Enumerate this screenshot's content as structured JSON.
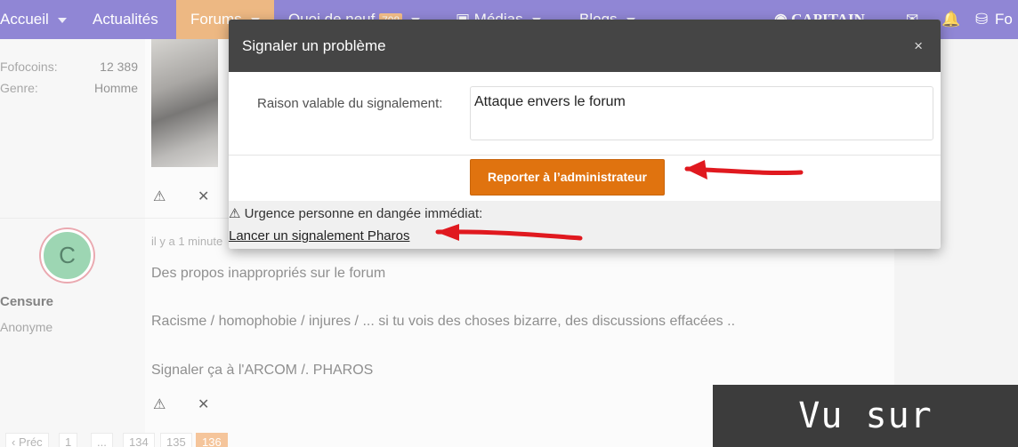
{
  "nav": {
    "items": [
      {
        "label": "Accueil"
      },
      {
        "label": "Actualités"
      },
      {
        "label": "Forums"
      },
      {
        "label": "Quoi de neuf",
        "badge": "708"
      },
      {
        "label": "Médias"
      },
      {
        "label": "Blogs"
      }
    ],
    "user": "CAPITAIN",
    "right_label": "Fo"
  },
  "sidebar": {
    "stats": [
      {
        "label": "Fofocoins:",
        "value": "12 389"
      },
      {
        "label": "Genre:",
        "value": "Homme"
      }
    ]
  },
  "post": {
    "avatar_letter": "C",
    "username": "Censure",
    "role": "Anonyme",
    "time": "il y a 1 minute",
    "lines": [
      "Des propos inappropriés sur le forum",
      "Racisme / homophobie / injures / ... si tu vois des choses bizarre, des discussions effacées ..",
      "Signaler ça à l'ARCOM /. PHAROS"
    ]
  },
  "pager": {
    "prev": "Préc",
    "pages": [
      "1",
      "...",
      "134",
      "135",
      "136"
    ],
    "current": "136"
  },
  "modal": {
    "title": "Signaler un problème",
    "close": "×",
    "reason_label": "Raison valable du signalement:",
    "reason_value": "Attaque envers le forum",
    "submit_label": "Reporter à l’administrateur",
    "urgent_text": "⚠ Urgence personne en dangée immédiat:",
    "pharos_link": "Lancer un signalement Pharos"
  },
  "watermark": "Vu sur Foforum",
  "colors": {
    "nav_bg": "#6b5ec7",
    "active_tab": "#e7a15a",
    "submit_button": "#e0730f",
    "annotation_arrow": "#e0191f"
  }
}
